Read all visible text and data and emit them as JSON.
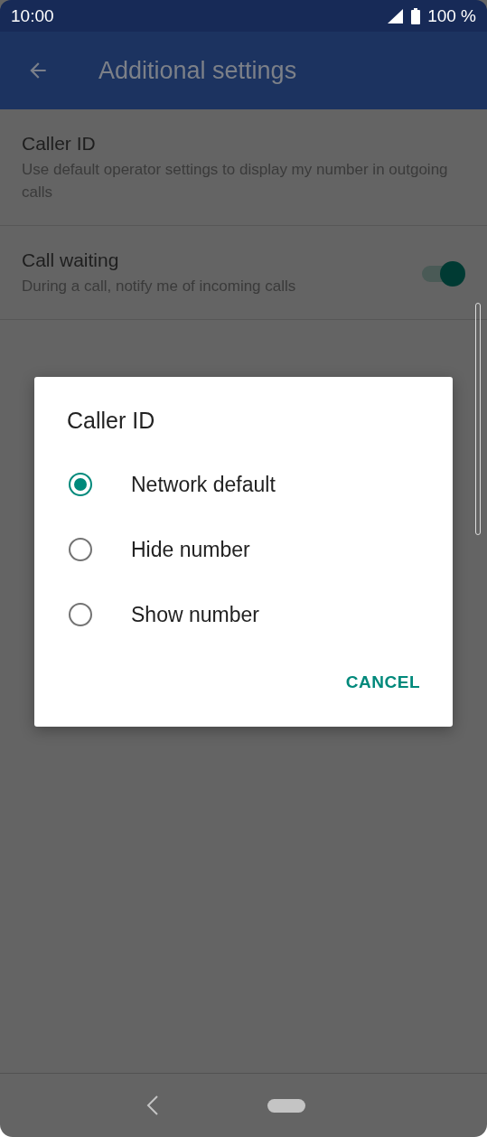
{
  "status_bar": {
    "time": "10:00",
    "battery": "100 %"
  },
  "app_bar": {
    "title": "Additional settings"
  },
  "settings": [
    {
      "kind": "text",
      "title": "Caller ID",
      "summary": "Use default operator settings to display my number in outgoing calls"
    },
    {
      "kind": "switch",
      "title": "Call waiting",
      "summary": "During a call, notify me of incoming calls",
      "on": true
    }
  ],
  "dialog": {
    "title": "Caller ID",
    "options": [
      {
        "label": "Network default",
        "selected": true
      },
      {
        "label": "Hide number",
        "selected": false
      },
      {
        "label": "Show number",
        "selected": false
      }
    ],
    "buttons": [
      "CANCEL"
    ]
  }
}
